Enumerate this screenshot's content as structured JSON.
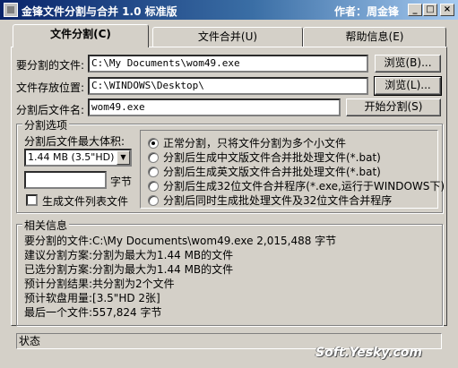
{
  "window": {
    "title": "金锋文件分割与合并 1.0 标准版",
    "author": "作者：周金锋",
    "minimize": "_",
    "maximize": "□",
    "close": "×"
  },
  "tabs": [
    {
      "label": "文件分割(C)"
    },
    {
      "label": "文件合并(U)"
    },
    {
      "label": "帮助信息(E)"
    }
  ],
  "split": {
    "source_label": "要分割的文件:",
    "source_value": "C:\\My Documents\\wom49.exe",
    "browse1_label": "浏览(B)...",
    "dest_label": "文件存放位置:",
    "dest_value": "C:\\WINDOWS\\Desktop\\",
    "browse2_label": "浏览(L)...",
    "name_label": "分割后文件名:",
    "name_value": "wom49.exe",
    "start_label": "开始分割(S)"
  },
  "options": {
    "group_title": "分割选项",
    "max_size_label": "分割后文件最大体积:",
    "max_size_value": "1.44 MB (3.5\"HD)",
    "bytes_unit": "字节",
    "bytes_value": "",
    "list_checkbox_label": "生成文件列表文件",
    "list_checkbox_checked": false,
    "modes": [
      {
        "label": "正常分割，只将文件分割为多个小文件",
        "selected": true
      },
      {
        "label": "分割后生成中文版文件合并批处理文件(*.bat)",
        "selected": false
      },
      {
        "label": "分割后生成英文版文件合并批处理文件(*.bat)",
        "selected": false
      },
      {
        "label": "分割后生成32位文件合并程序(*.exe,运行于WINDOWS下)",
        "selected": false
      },
      {
        "label": "分割后同时生成批处理文件及32位文件合并程序",
        "selected": false
      }
    ]
  },
  "info": {
    "group_title": "相关信息",
    "lines": [
      "要分割的文件:C:\\My Documents\\wom49.exe  2,015,488 字节",
      "建议分割方案:分割为最大为1.44 MB的文件",
      "已选分割方案:分割为最大为1.44 MB的文件",
      "预计分割结果:共分割为2个文件",
      "预计软盘用量:[3.5\"HD 2张]",
      "最后一个文件:557,824 字节"
    ]
  },
  "status": {
    "text": "状态"
  },
  "watermark": {
    "text": "Soft.Yesky.com"
  }
}
